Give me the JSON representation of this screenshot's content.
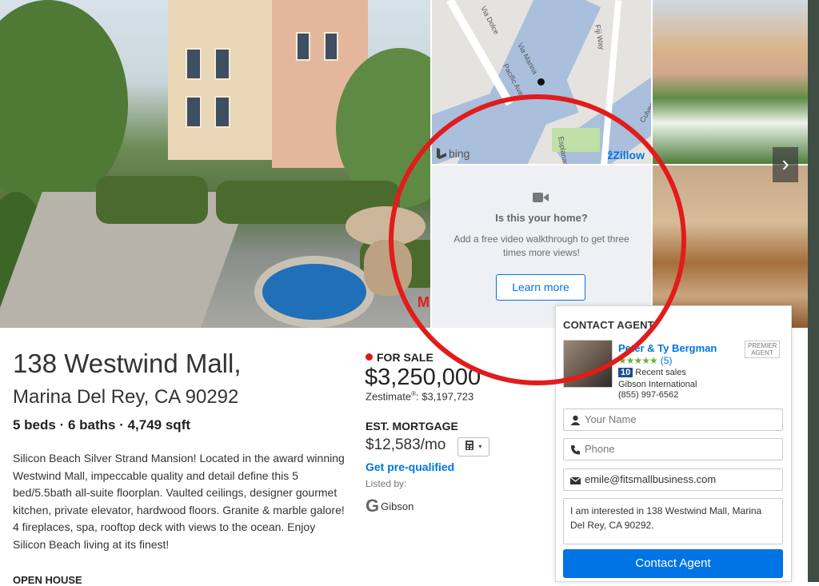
{
  "photos": {
    "next_arrow": "›",
    "watermark": "M"
  },
  "map": {
    "streets": [
      "Via Dolce",
      "Via Marina",
      "Pacific Ave",
      "Fiji Way",
      "Esplanade",
      "Culver"
    ],
    "bing_label": "bing",
    "zillow_label": "Zillow"
  },
  "promo": {
    "title": "Is this your home?",
    "text": "Add a free video walkthrough to get three times more views!",
    "button": "Learn more"
  },
  "listing": {
    "address_line1": "138 Westwind Mall,",
    "address_line2": "Marina Del Rey, CA 90292",
    "facts": "5 beds · 6 baths · 4,749 sqft",
    "description": "Silicon Beach Silver Strand Mansion! Located in the award winning Westwind Mall, impeccable quality and detail define this 5 bed/5.5bath all-suite floorplan. Vaulted ceilings, designer gourmet kitchen, private elevator, hardwood floors. Granite & marble galore! 4 fireplaces, spa, rooftop deck with views to the ocean. Enjoy Silicon Beach living at its finest!",
    "open_house_label": "OPEN HOUSE",
    "status": "FOR SALE",
    "status_color": "#d51d1d",
    "price": "$3,250,000",
    "zestimate_label": "Zestimate",
    "zestimate_value": ": $3,197,723",
    "mortgage_label": "EST. MORTGAGE",
    "mortgage_value": "$12,583/mo",
    "prequal_link": "Get pre-qualified",
    "listed_by_label": "Listed by:",
    "broker_logo_text": "Gibson"
  },
  "contact": {
    "title": "CONTACT AGENT",
    "agent_name": "Peter & Ty Bergman",
    "premier_badge": "PREMIER AGENT",
    "rating_stars": "★★★★★",
    "review_count": "(5)",
    "recent_sales_count": "10",
    "recent_sales_label": "Recent sales",
    "brokerage": "Gibson International",
    "phone": "(855) 997-6562",
    "name_placeholder": "Your Name",
    "phone_placeholder": "Phone",
    "email_value": "emile@fitsmallbusiness.com",
    "message_value": "I am interested in 138 Westwind Mall, Marina Del Rey, CA 90292.",
    "submit_button": "Contact Agent"
  },
  "colors": {
    "accent": "#0074e4",
    "annotation": "#e21b1b",
    "star": "#6bb33a"
  }
}
